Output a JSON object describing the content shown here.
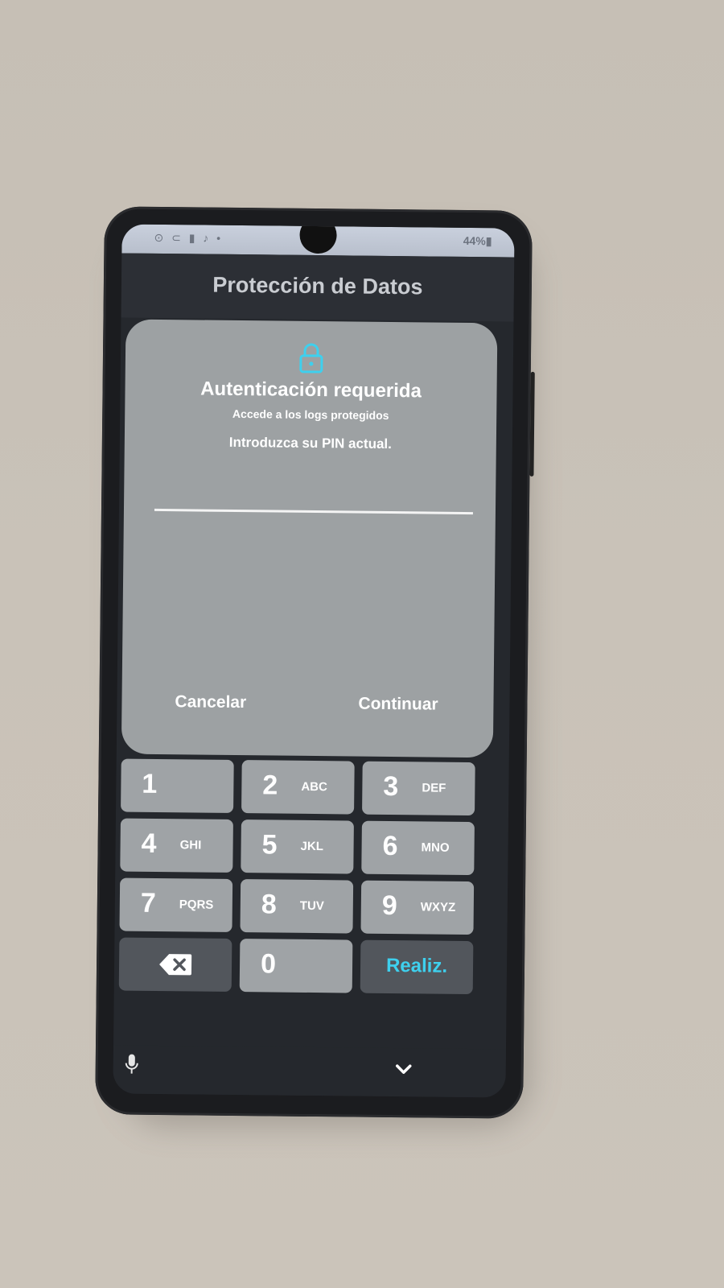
{
  "statusbar": {
    "left": "⊙ ⊂ ▮ ♪ •",
    "right": "44%▮"
  },
  "app": {
    "title": "Protección de Datos"
  },
  "dialog": {
    "title": "Autenticación requerida",
    "subtitle": "Accede a los logs protegidos",
    "prompt": "Introduzca su PIN actual.",
    "pin_value": "",
    "cancel_label": "Cancelar",
    "continue_label": "Continuar"
  },
  "keypad": {
    "keys": [
      {
        "digit": "1",
        "letters": ""
      },
      {
        "digit": "2",
        "letters": "ABC"
      },
      {
        "digit": "3",
        "letters": "DEF"
      },
      {
        "digit": "4",
        "letters": "GHI"
      },
      {
        "digit": "5",
        "letters": "JKL"
      },
      {
        "digit": "6",
        "letters": "MNO"
      },
      {
        "digit": "7",
        "letters": "PQRS"
      },
      {
        "digit": "8",
        "letters": "TUV"
      },
      {
        "digit": "9",
        "letters": "WXYZ"
      }
    ],
    "zero": "0",
    "done_label": "Realiz.",
    "backspace_icon": "backspace-icon"
  },
  "icons": {
    "lock": "lock-icon",
    "mic": "microphone-icon",
    "hide_keyboard": "chevron-down-icon"
  },
  "colors": {
    "accent": "#3ed0ee",
    "dialog_bg": "#9da1a3",
    "key_bg": "#9fa3a6",
    "key_dark": "#52565c"
  }
}
